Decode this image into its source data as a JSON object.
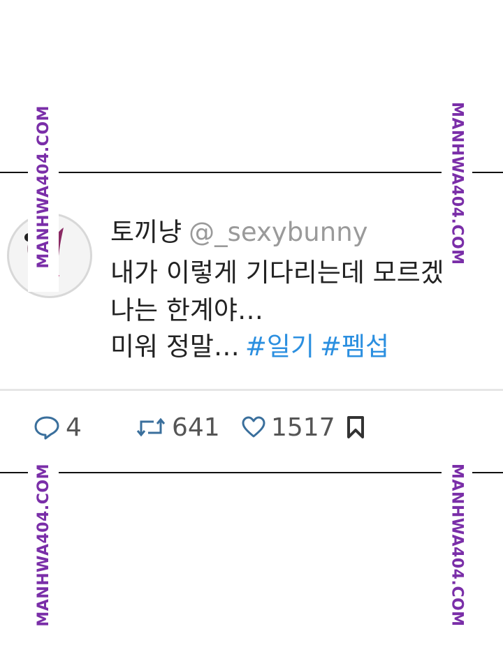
{
  "tweet": {
    "display_name": "토끼냥",
    "handle": "@_sexybunny",
    "lines": [
      "내가 이렇게 기다리는데 모르겠니",
      "나는 한계야…",
      "미워 정말…"
    ],
    "hashtags": [
      "#일기",
      "#펨섭"
    ],
    "avatar_icon": "bunny-logo"
  },
  "actions": {
    "replies": "4",
    "retweets": "641",
    "likes": "1517",
    "bookmark_icon": "bookmark-icon"
  },
  "watermark": {
    "text": "MANHWA404.COM",
    "color": "#7a2ea8"
  },
  "colors": {
    "hashtag": "#2b8fe0",
    "handle": "#9a9a9a",
    "text": "#222222"
  }
}
